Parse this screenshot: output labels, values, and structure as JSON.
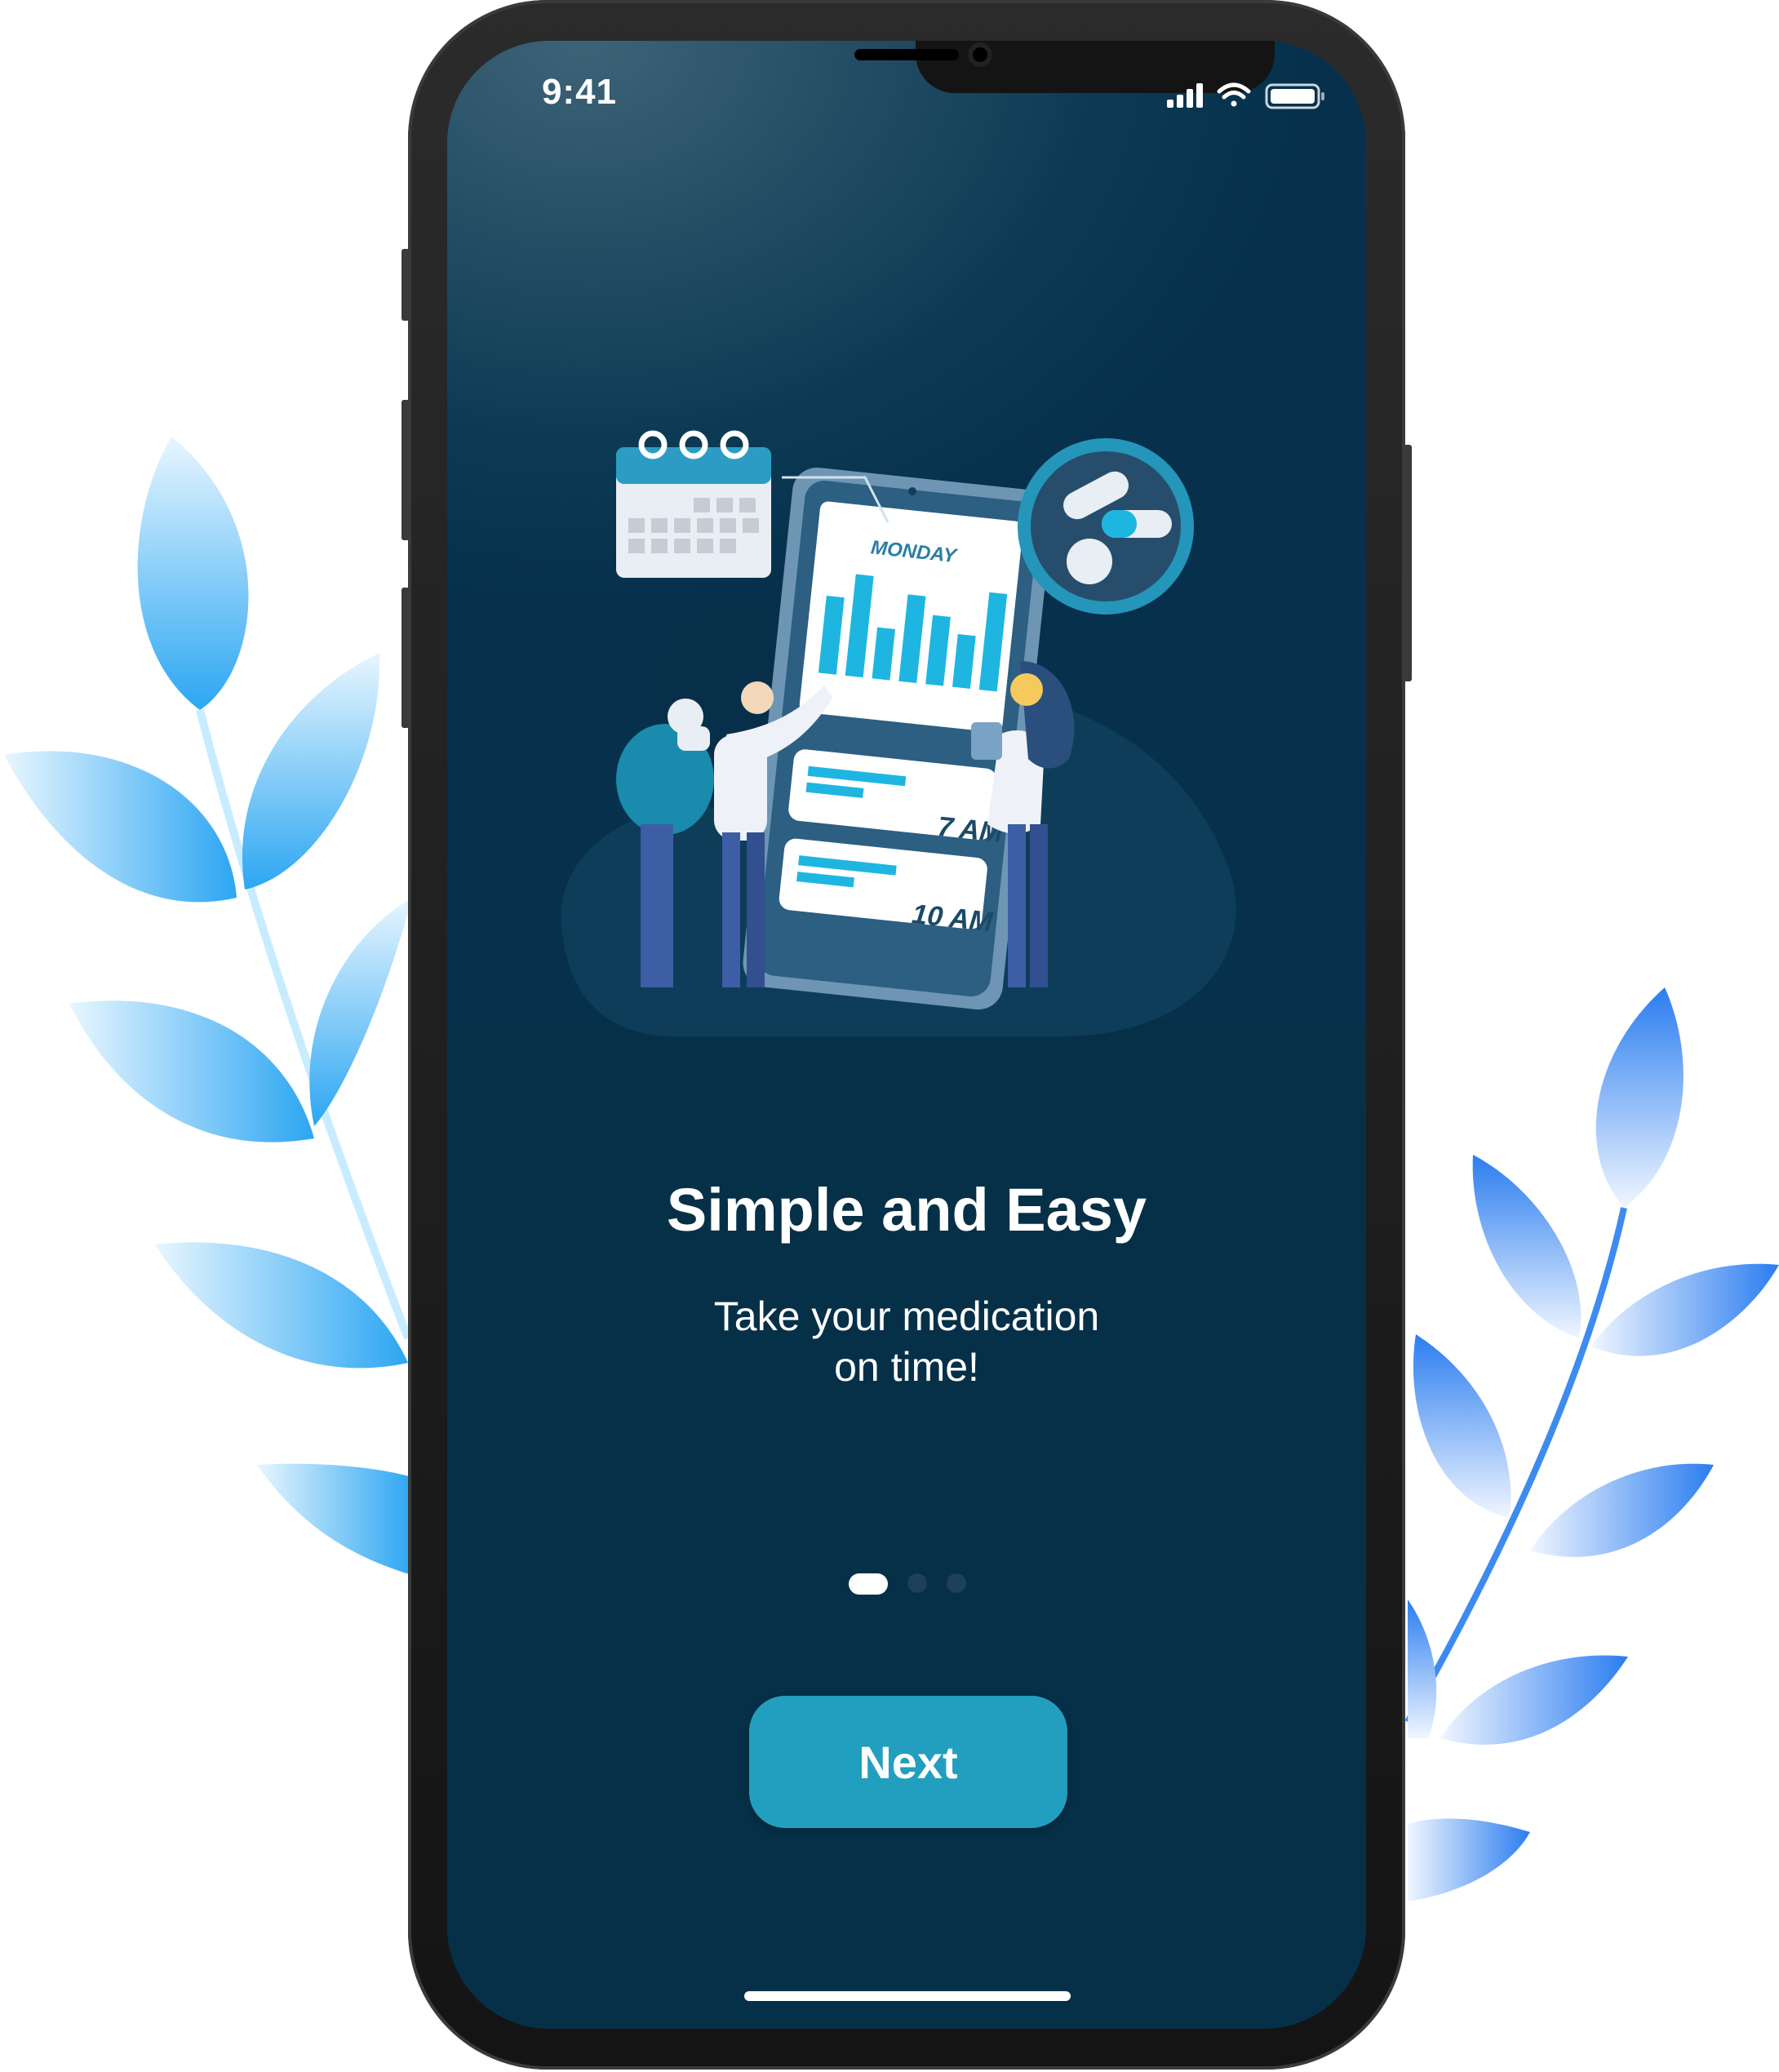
{
  "status_bar": {
    "time": "9:41",
    "icons": [
      "signal-icon",
      "wifi-icon",
      "battery-icon"
    ]
  },
  "illustration": {
    "day_label": "MONDAY",
    "reminders": [
      "7 AM",
      "10 AM"
    ]
  },
  "onboarding": {
    "title": "Simple and Easy",
    "subtitle_line1": "Take your medication",
    "subtitle_line2": "on time!",
    "page_indicator": {
      "current": 1,
      "total": 3
    },
    "next_label": "Next"
  },
  "colors": {
    "screen_bg": "#063048",
    "accent": "#229fbe",
    "leaf_light": "#4fb8f3",
    "leaf_blue": "#3d8bf0"
  }
}
